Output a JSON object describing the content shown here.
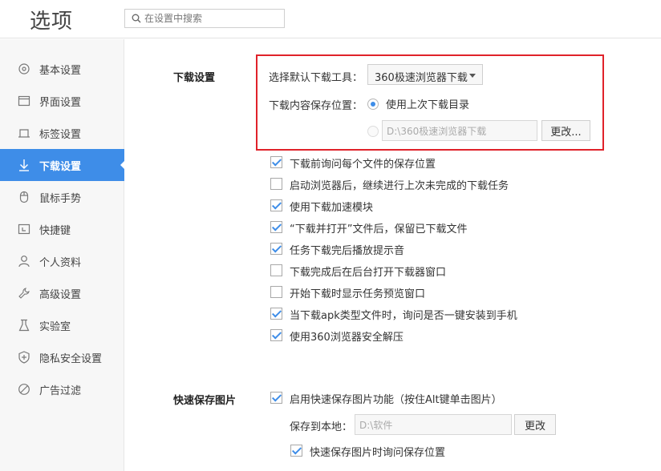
{
  "header": {
    "title": "选项",
    "search_placeholder": "在设置中搜索"
  },
  "sidebar": {
    "items": [
      {
        "label": "基本设置",
        "icon": "gear-icon",
        "active": false
      },
      {
        "label": "界面设置",
        "icon": "window-icon",
        "active": false
      },
      {
        "label": "标签设置",
        "icon": "tab-icon",
        "active": false
      },
      {
        "label": "下载设置",
        "icon": "download-icon",
        "active": true
      },
      {
        "label": "鼠标手势",
        "icon": "mouse-icon",
        "active": false
      },
      {
        "label": "快捷键",
        "icon": "shortcut-icon",
        "active": false
      },
      {
        "label": "个人资料",
        "icon": "user-icon",
        "active": false
      },
      {
        "label": "高级设置",
        "icon": "wrench-icon",
        "active": false
      },
      {
        "label": "实验室",
        "icon": "flask-icon",
        "active": false
      },
      {
        "label": "隐私安全设置",
        "icon": "shield-icon",
        "active": false
      },
      {
        "label": "广告过滤",
        "icon": "block-icon",
        "active": false
      }
    ]
  },
  "download": {
    "section_title": "下载设置",
    "tool_label": "选择默认下载工具：",
    "tool_value": "360极速浏览器下载",
    "location_label": "下载内容保存位置：",
    "use_last_label": "使用上次下载目录",
    "path_value": "D:\\360极速浏览器下载",
    "change_button": "更改...",
    "options": [
      {
        "label": "下载前询问每个文件的保存位置",
        "checked": true
      },
      {
        "label": "启动浏览器后，继续进行上次未完成的下载任务",
        "checked": false
      },
      {
        "label": "使用下载加速模块",
        "checked": true
      },
      {
        "label": "“下载并打开”文件后，保留已下载文件",
        "checked": true
      },
      {
        "label": "任务下载完后播放提示音",
        "checked": true
      },
      {
        "label": "下载完成后在后台打开下载器窗口",
        "checked": false
      },
      {
        "label": "开始下载时显示任务预览窗口",
        "checked": false
      },
      {
        "label": "当下载apk类型文件时，询问是否一键安装到手机",
        "checked": true
      },
      {
        "label": "使用360浏览器安全解压",
        "checked": true
      }
    ]
  },
  "quick_save": {
    "section_title": "快速保存图片",
    "enable_label": "启用快速保存图片功能（按住Alt键单击图片）",
    "save_to_label": "保存到本地：",
    "path_value": "D:\\软件",
    "change_button": "更改",
    "ask_label": "快速保存图片时询问保存位置"
  },
  "colors": {
    "accent": "#3e8de8",
    "highlight_box": "#e0222a"
  }
}
